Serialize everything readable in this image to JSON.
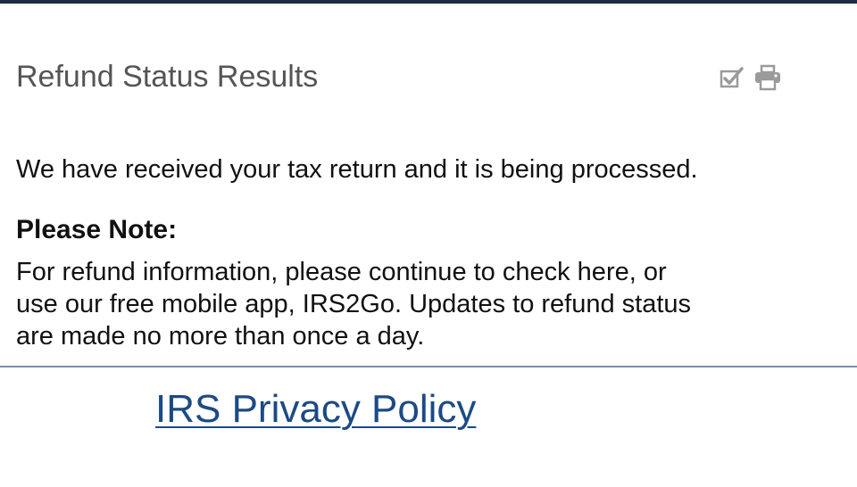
{
  "colors": {
    "top_bar": "#1f2a44",
    "title_text": "#555555",
    "body_text": "#111111",
    "icon": "#9a9a9a",
    "divider": "#7a8fb0",
    "link": "#1b4a86"
  },
  "header": {
    "title": "Refund Status Results",
    "icons": [
      "checkbox-icon",
      "print-icon"
    ]
  },
  "status": {
    "message": "We have received your tax return and it is being processed."
  },
  "note": {
    "heading": "Please Note:",
    "lines": [
      "For refund information, please continue to check here, or",
      "use our free mobile app, IRS2Go. Updates to refund status",
      "are made no more than once a day."
    ]
  },
  "footer": {
    "privacy_link": "IRS Privacy Policy"
  }
}
